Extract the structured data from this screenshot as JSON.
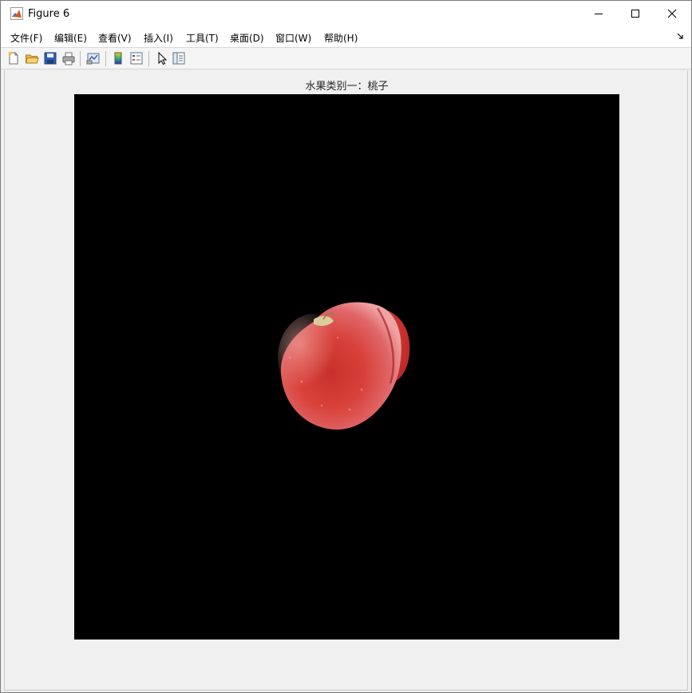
{
  "window": {
    "title": "Figure 6",
    "app_icon": "matlab-logo-icon",
    "controls": [
      "minimize-icon",
      "maximize-icon",
      "close-icon"
    ]
  },
  "menubar": {
    "items": [
      {
        "label": "文件(F)"
      },
      {
        "label": "编辑(E)"
      },
      {
        "label": "查看(V)"
      },
      {
        "label": "插入(I)"
      },
      {
        "label": "工具(T)"
      },
      {
        "label": "桌面(D)"
      },
      {
        "label": "窗口(W)"
      },
      {
        "label": "帮助(H)"
      }
    ],
    "overflow_icon": "toolbar-dock-arrow-icon"
  },
  "toolbar": {
    "buttons": [
      "new-figure-icon",
      "open-file-icon",
      "save-figure-icon",
      "print-figure-icon",
      "link-plot-icon",
      "insert-colorbar-icon",
      "insert-legend-icon",
      "edit-plot-icon",
      "property-inspector-icon"
    ]
  },
  "figure": {
    "axes_title": "水果类别一：桃子",
    "image_subject": "peach-fruit",
    "background_color": "#000000"
  }
}
